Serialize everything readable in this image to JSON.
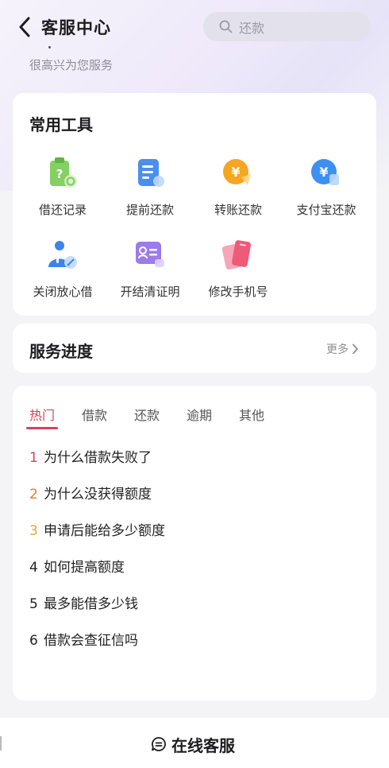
{
  "header": {
    "title": "客服中心",
    "search_placeholder": "还款",
    "greeting": "很高兴为您服务"
  },
  "tools": {
    "title": "常用工具",
    "items": [
      {
        "label": "借还记录",
        "icon": "loan-record-icon",
        "color": "#7fc95d"
      },
      {
        "label": "提前还款",
        "icon": "early-repay-icon",
        "color": "#4a8ff0"
      },
      {
        "label": "转账还款",
        "icon": "transfer-repay-icon",
        "color": "#f5a623"
      },
      {
        "label": "支付宝还款",
        "icon": "alipay-repay-icon",
        "color": "#3d8ff2"
      },
      {
        "label": "关闭放心借",
        "icon": "close-service-icon",
        "color": "#3e84ea"
      },
      {
        "label": "开结清证明",
        "icon": "settlement-cert-icon",
        "color": "#9b7ce8"
      },
      {
        "label": "修改手机号",
        "icon": "change-phone-icon",
        "color": "#ef5a78"
      }
    ]
  },
  "progress": {
    "title": "服务进度",
    "more_label": "更多"
  },
  "faq": {
    "tabs": [
      "热门",
      "借款",
      "还款",
      "逾期",
      "其他"
    ],
    "active_tab": 0,
    "items": [
      {
        "num": "1",
        "text": "为什么借款失败了",
        "color": "#d9415a"
      },
      {
        "num": "2",
        "text": "为什么没获得额度",
        "color": "#e07b3a"
      },
      {
        "num": "3",
        "text": "申请后能给多少额度",
        "color": "#e0a92f"
      },
      {
        "num": "4",
        "text": "如何提高额度",
        "color": "#222222"
      },
      {
        "num": "5",
        "text": "最多能借多少钱",
        "color": "#222222"
      },
      {
        "num": "6",
        "text": "借款会查征信吗",
        "color": "#222222"
      }
    ]
  },
  "bottom": {
    "online_service_label": "在线客服"
  }
}
